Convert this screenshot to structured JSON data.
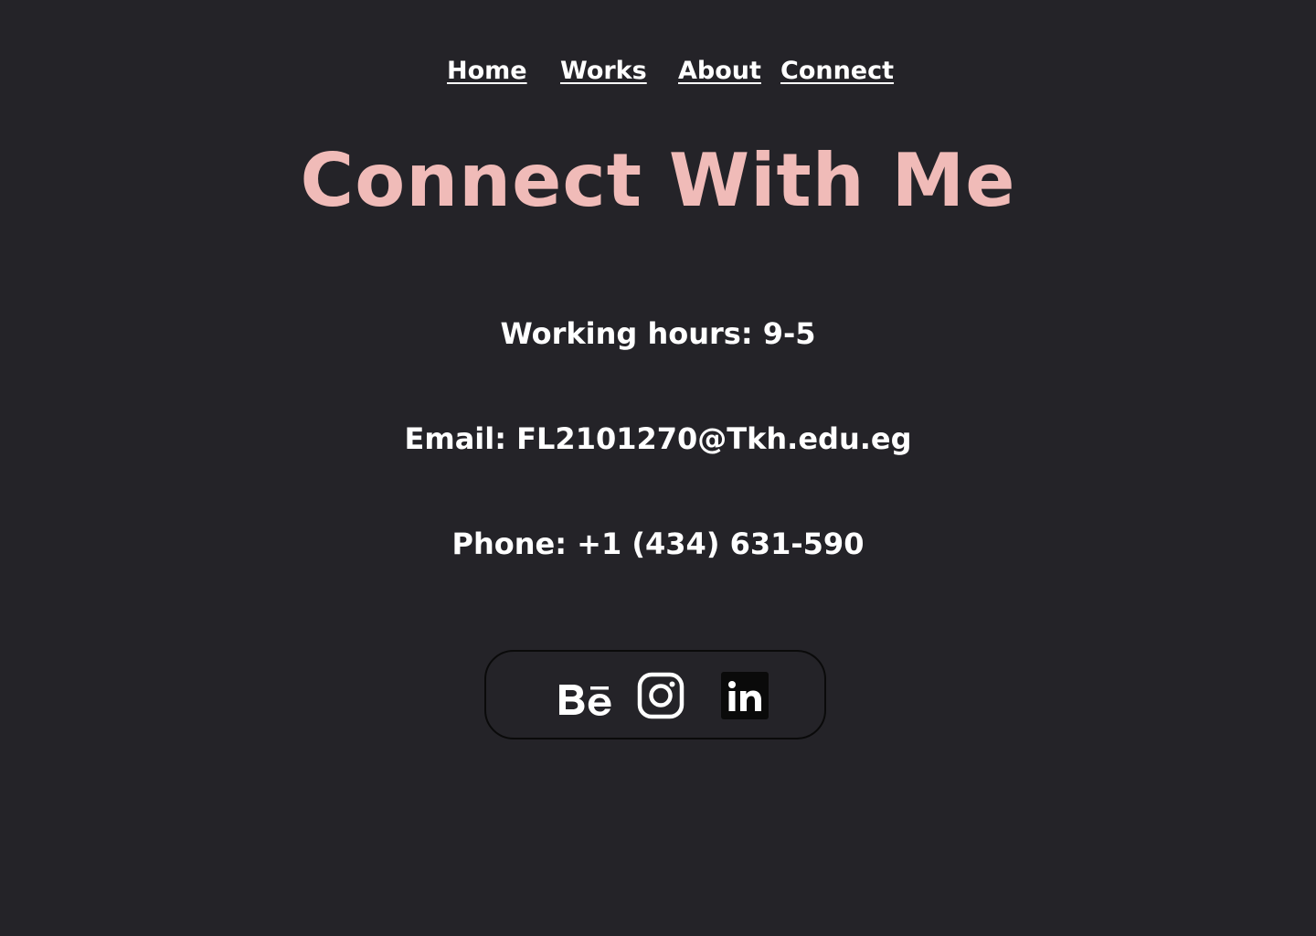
{
  "nav": {
    "home": "Home",
    "works": "Works",
    "about": "About",
    "connect": "Connect"
  },
  "heading": "Connect With Me",
  "contact": {
    "hours": "Working hours: 9-5",
    "email": "Email: FL2101270@Tkh.edu.eg",
    "phone": "Phone: +1 (434) 631-590"
  },
  "social": {
    "icons": [
      "behance-icon",
      "instagram-icon",
      "linkedin-icon"
    ]
  },
  "colors": {
    "background": "#242328",
    "heading": "#f0bbb8",
    "text": "#ffffff",
    "box_border": "#0a0a0a"
  }
}
